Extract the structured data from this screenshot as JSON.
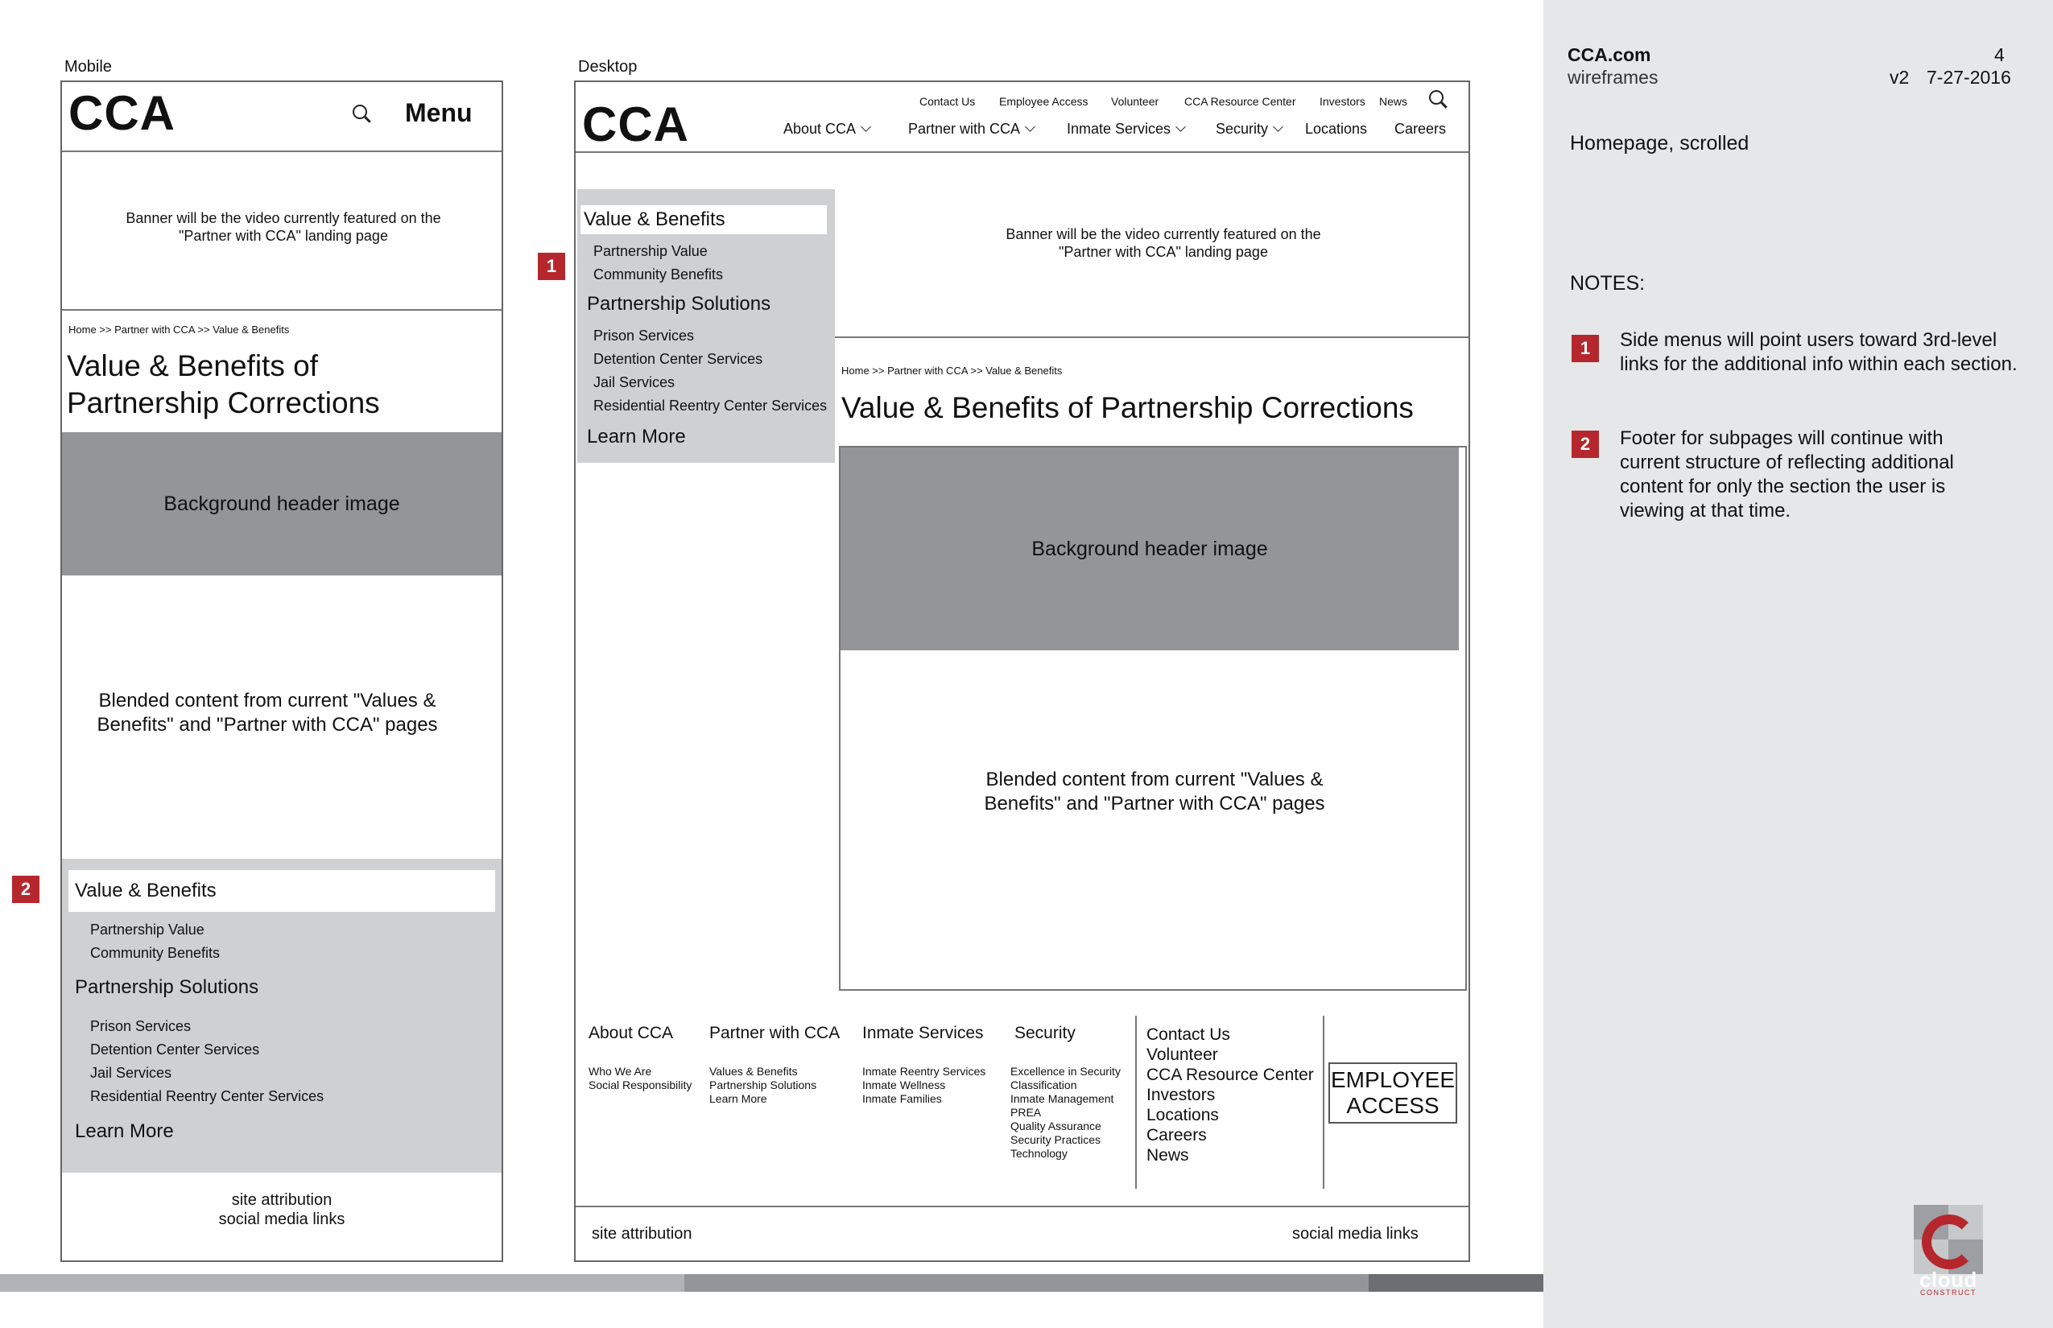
{
  "labels": {
    "mobile": "Mobile",
    "desktop": "Desktop"
  },
  "brand": "CCA",
  "mobile": {
    "menu_label": "Menu",
    "banner_text": "Banner will be the video currently featured on the \"Partner with CCA\" landing page",
    "breadcrumb": "Home >> Partner with CCA >> Value & Benefits",
    "page_title": "Value & Benefits of Partnership Corrections",
    "header_image": "Background header image",
    "content_text": "Blended content from current \"Values & Benefits\" and \"Partner with CCA\" pages",
    "footer_attribution": "site attribution",
    "footer_social": "social media links"
  },
  "side_menu": {
    "section1": "Value & Benefits",
    "section1_items": [
      "Partnership Value",
      "Community Benefits"
    ],
    "section2": "Partnership Solutions",
    "section2_items": [
      "Prison Services",
      "Detention Center Services",
      "Jail Services",
      "Residential Reentry Center Services"
    ],
    "learn_more": "Learn More"
  },
  "desktop": {
    "utility_nav": [
      "Contact Us",
      "Employee Access",
      "Volunteer",
      "CCA Resource Center",
      "Investors",
      "News"
    ],
    "main_nav": [
      "About CCA",
      "Partner with CCA",
      "Inmate Services",
      "Security",
      "Locations",
      "Careers"
    ],
    "banner_text": "Banner will be the video currently featured on the \"Partner with CCA\" landing page",
    "breadcrumb": "Home >> Partner with CCA >> Value & Benefits",
    "page_title": "Value & Benefits of Partnership Corrections",
    "header_image": "Background header image",
    "content_text": "Blended content from current \"Values & Benefits\" and \"Partner with CCA\" pages",
    "footer": {
      "col1_title": "About CCA",
      "col1_items": [
        "Who We Are",
        "Social Responsibility"
      ],
      "col2_title": "Partner with CCA",
      "col2_items": [
        "Values & Benefits",
        "Partnership Solutions",
        "Learn More"
      ],
      "col3_title": "Inmate Services",
      "col3_items": [
        "Inmate Reentry Services",
        "Inmate Wellness",
        "Inmate Families"
      ],
      "col4_title": "Security",
      "col4_items": [
        "Excellence in Security",
        "Classification",
        "Inmate Management",
        "PREA",
        "Quality Assurance",
        "Security Practices",
        "Technology"
      ],
      "links": [
        "Contact Us",
        "Volunteer",
        "CCA Resource Center",
        "Investors",
        "Locations",
        "Careers",
        "News"
      ],
      "employee_access": "EMPLOYEE ACCESS",
      "attribution": "site attribution",
      "social": "social media links"
    }
  },
  "notes_panel": {
    "title": "CCA.com",
    "subtitle": "wireframes",
    "page_number": "4",
    "version": "v2",
    "date": "7-27-2016",
    "page_desc": "Homepage, scrolled",
    "notes_heading": "NOTES:",
    "notes": [
      {
        "number": "1",
        "text": "Side menus will point users toward 3rd-level links for the additional info within each section."
      },
      {
        "number": "2",
        "text": "Footer for subpages will continue with current structure of reflecting additional content for only the section the user is viewing at that time."
      }
    ],
    "logo_text": "cloud",
    "logo_subtext": "CONSTRUCT"
  },
  "colors": {
    "accent": "#b5272d",
    "panel": "#e6e7e8",
    "sidemenu": "#cfd0d2",
    "image": "#939598"
  }
}
